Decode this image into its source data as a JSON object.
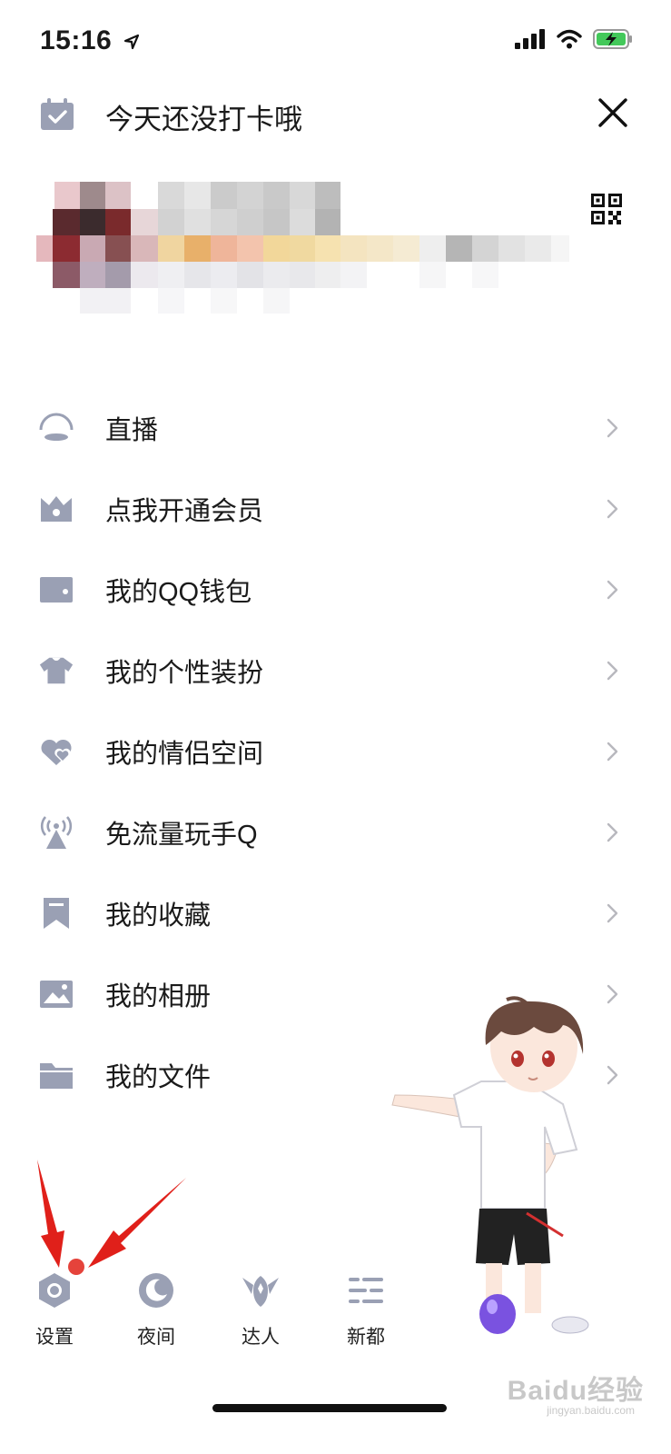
{
  "status_bar": {
    "time": "15:16"
  },
  "header": {
    "checkin_text": "今天还没打卡哦"
  },
  "menu": {
    "items": [
      {
        "label": "直播",
        "icon": "live-icon"
      },
      {
        "label": "点我开通会员",
        "icon": "vip-crown-icon"
      },
      {
        "label": "我的QQ钱包",
        "icon": "wallet-icon"
      },
      {
        "label": "我的个性装扮",
        "icon": "tshirt-icon"
      },
      {
        "label": "我的情侣空间",
        "icon": "couple-hearts-icon"
      },
      {
        "label": "免流量玩手Q",
        "icon": "signal-tower-icon"
      },
      {
        "label": "我的收藏",
        "icon": "bookmark-icon"
      },
      {
        "label": "我的相册",
        "icon": "photo-album-icon"
      },
      {
        "label": "我的文件",
        "icon": "folder-icon"
      }
    ]
  },
  "bottom_bar": {
    "settings": "设置",
    "night": "夜间",
    "expert": "达人",
    "news": "新都"
  },
  "watermark": {
    "text": "Baidu经验",
    "sub": "jingyan.baidu.com"
  },
  "colors": {
    "icon": "#9aa0b4",
    "badge": "#e5433b",
    "arrow": "#e0201a"
  }
}
